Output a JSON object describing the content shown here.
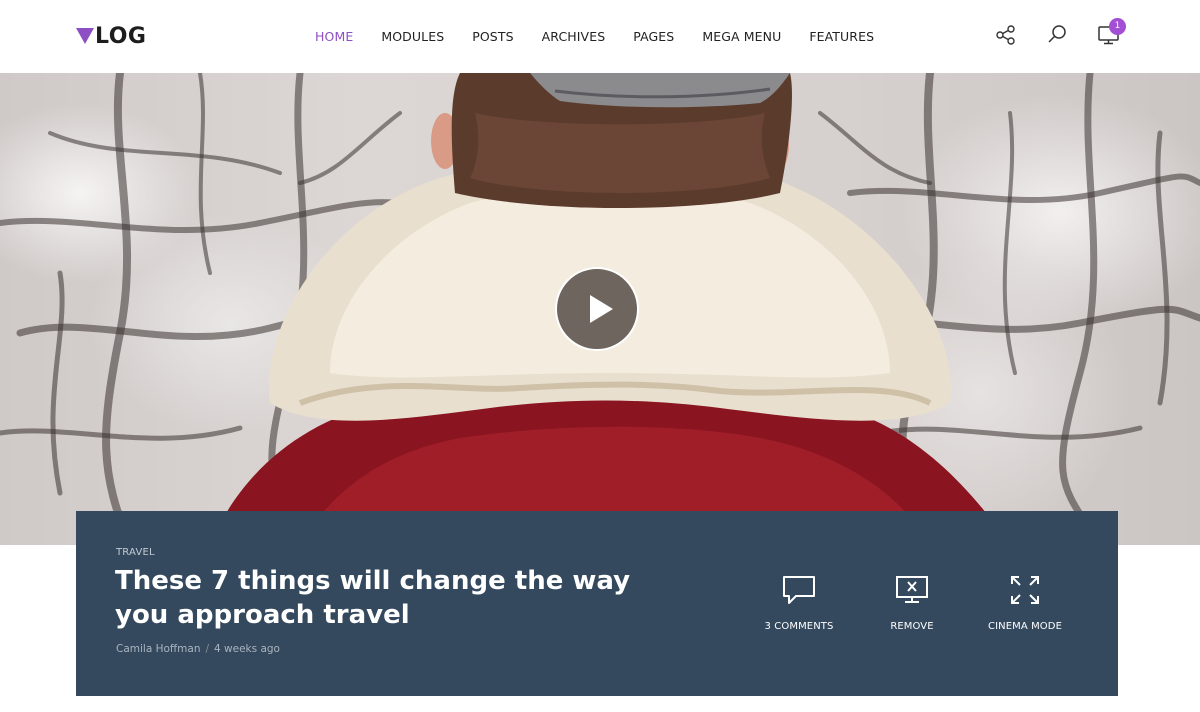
{
  "header": {
    "logo_text": "LOG",
    "nav": [
      {
        "label": "HOME",
        "active": true
      },
      {
        "label": "MODULES"
      },
      {
        "label": "POSTS"
      },
      {
        "label": "ARCHIVES"
      },
      {
        "label": "PAGES"
      },
      {
        "label": "MEGA MENU"
      },
      {
        "label": "FEATURES"
      }
    ],
    "icons": [
      "share-icon",
      "search-icon",
      "monitor-icon"
    ],
    "notification_count": "1",
    "accent_color": "#8f4fc4"
  },
  "hero": {
    "play_icon": "play-icon"
  },
  "post": {
    "category": "TRAVEL",
    "title": "These 7 things will change the way you approach travel",
    "author": "Camila Hoffman",
    "separator": "/",
    "date": "4 weeks ago",
    "panel_color": "#34495e",
    "actions": [
      {
        "label": "3 COMMENTS",
        "icon": "comment-icon"
      },
      {
        "label": "REMOVE",
        "icon": "remove-screen-icon"
      },
      {
        "label": "CINEMA MODE",
        "icon": "expand-icon"
      }
    ]
  }
}
